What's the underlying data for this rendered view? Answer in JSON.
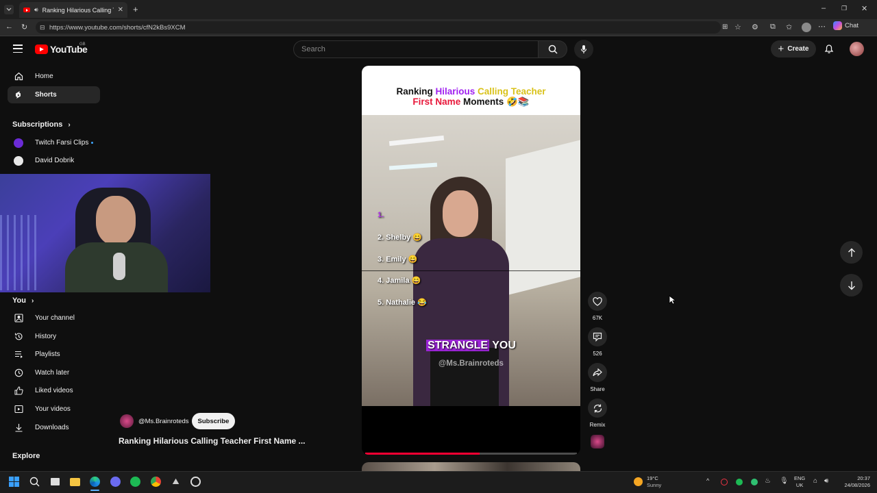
{
  "browser": {
    "tab_title": "Ranking Hilarious Calling Teac",
    "url": "https://www.youtube.com/shorts/cfN2kBs9XCM",
    "chat_label": "Chat"
  },
  "youtube": {
    "logo_text": "YouTube",
    "region": "GB",
    "search_placeholder": "Search",
    "create_label": "Create"
  },
  "sidebar": {
    "top": [
      {
        "label": "Home",
        "icon": "home-icon"
      },
      {
        "label": "Shorts",
        "icon": "shorts-icon"
      }
    ],
    "subscriptions_heading": "Subscriptions",
    "subscriptions": [
      {
        "label": "Twitch Farsi Clips"
      },
      {
        "label": "David Dobrik"
      }
    ],
    "you_heading": "You",
    "you_items": [
      {
        "label": "Your channel",
        "icon": "channel-icon"
      },
      {
        "label": "History",
        "icon": "history-icon"
      },
      {
        "label": "Playlists",
        "icon": "playlists-icon"
      },
      {
        "label": "Watch later",
        "icon": "clock-icon"
      },
      {
        "label": "Liked videos",
        "icon": "thumbs-up-icon"
      },
      {
        "label": "Your videos",
        "icon": "play-box-icon"
      },
      {
        "label": "Downloads",
        "icon": "download-icon"
      }
    ],
    "explore_heading": "Explore"
  },
  "short": {
    "title_line1_a": "Ranking ",
    "title_line1_b": "Hilarious",
    "title_line1_c": " Calling Teacher",
    "title_line2_a": "First Name",
    "title_line2_b": " Moments 🤣📚",
    "rankings": [
      "1.",
      "2. Shelby 😄",
      "3. Emily 😄",
      "4. Jamila 😄",
      "5. Nathalie 😂"
    ],
    "caption_highlight": "STRANGLE",
    "caption_rest": " YOU",
    "watermark": "@Ms.Brainroteds",
    "channel_handle": "@Ms.Brainroteds",
    "subscribe_label": "Subscribe",
    "video_title": "Ranking Hilarious Calling Teacher First Name ...",
    "progress": 0.54,
    "likes": "67K",
    "comments": "526",
    "share_label": "Share",
    "remix_label": "Remix"
  },
  "taskbar": {
    "weather_temp": "19°C",
    "weather_desc": "Sunny",
    "lang_line1": "ENG",
    "lang_line2": "UK",
    "time": "20:37",
    "date": "24/08/2026"
  },
  "colors": {
    "brand_red": "#ff0000",
    "title_purple": "#a020f0",
    "title_yellow": "#e8d21a",
    "title_red": "#e8173a",
    "caption_highlight_bg": "#9b24d6"
  }
}
